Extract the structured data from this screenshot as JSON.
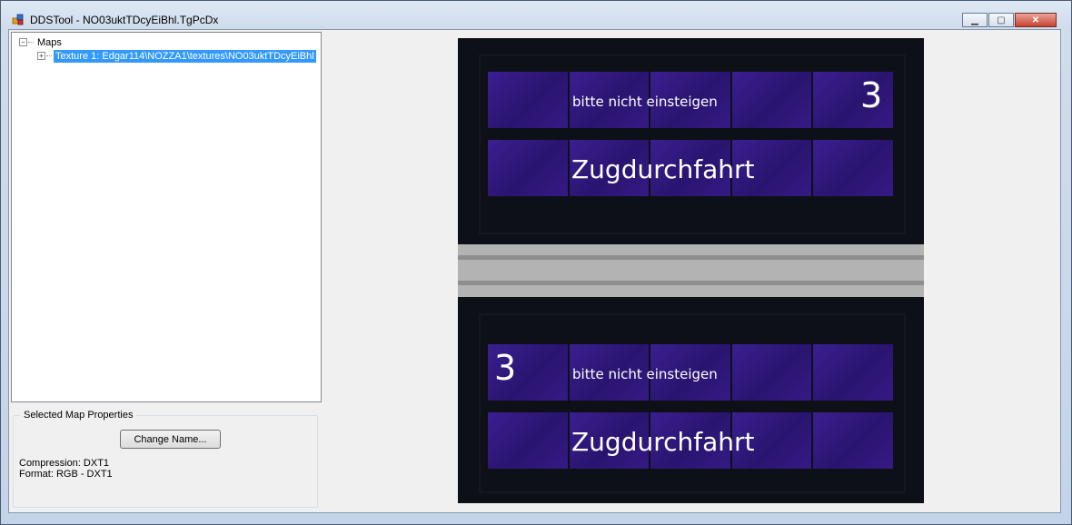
{
  "window": {
    "title": "DDSTool - NO03uktTDcyEiBhl.TgPcDx",
    "minimize_glyph": "▁",
    "maximize_glyph": "▢",
    "close_glyph": "✕"
  },
  "tree": {
    "root": {
      "label": "Maps",
      "expander": "−"
    },
    "items": [
      {
        "label": "Texture 1: Edgar114\\NOZZA1\\textures\\NO03uktTDcyEiBhl",
        "expander": "+"
      }
    ]
  },
  "properties": {
    "group_title": "Selected Map Properties",
    "change_name_label": "Change Name...",
    "compression": "Compression: DXT1",
    "format": "Format: RGB - DXT1"
  },
  "preview": {
    "top_sign": {
      "line1": "bitte nicht einsteigen",
      "line2": "Zugdurchfahrt",
      "number": "3"
    },
    "bottom_sign": {
      "line1": "bitte nicht einsteigen",
      "line2": "Zugdurchfahrt",
      "number": "3"
    }
  },
  "colors": {
    "selection": "#3399ff",
    "panel": "#2a1470",
    "background": "#f0f0f0"
  }
}
